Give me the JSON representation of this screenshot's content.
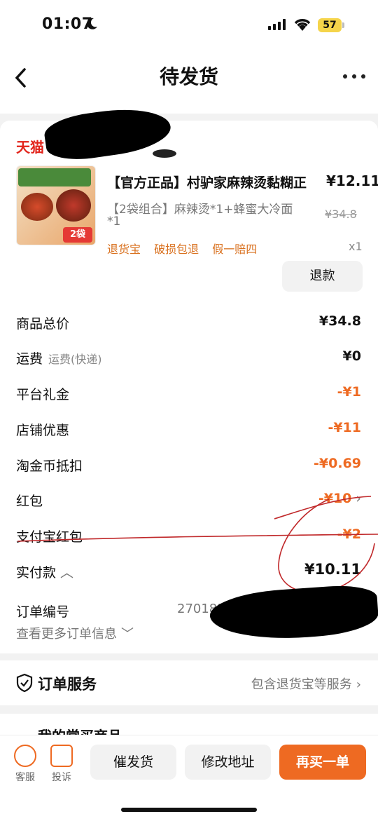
{
  "status": {
    "time": "01:07",
    "battery": "57"
  },
  "nav": {
    "title": "待发货"
  },
  "shop": {
    "brand": "天猫",
    "name_visible": "!!"
  },
  "product": {
    "image_badge": "2袋",
    "title": "【官方正品】村驴家麻辣烫黏糊正",
    "price": "¥12.11",
    "spec_line1": "【2袋组合】麻辣烫*1+蜂蜜大冷面",
    "spec_line2": "*1",
    "original_price": "¥34.8",
    "tags": [
      "退货宝",
      "破损包退",
      "假一赔四"
    ],
    "quantity": "x1",
    "refund_label": "退款"
  },
  "summary": {
    "rows": [
      {
        "label": "商品总价",
        "sub": "",
        "value": "¥34.8"
      },
      {
        "label": "运费",
        "sub": "运费(快递)",
        "value": "¥0"
      },
      {
        "label": "平台礼金",
        "sub": "",
        "value": "-¥1"
      },
      {
        "label": "店铺优惠",
        "sub": "",
        "value": "-¥11"
      },
      {
        "label": "淘金币抵扣",
        "sub": "",
        "value": "-¥0.69"
      },
      {
        "label": "红包",
        "sub": "",
        "value": "-¥10"
      },
      {
        "label": "支付宝红包",
        "sub": "",
        "value": "-¥2"
      },
      {
        "label": "实付款",
        "sub": "",
        "value": "¥10.11"
      }
    ]
  },
  "order": {
    "number_label": "订单编号",
    "number_visible": "27018371",
    "more_info": "查看更多订单信息"
  },
  "service": {
    "title": "订单服务",
    "right_text": "包含退货宝等服务"
  },
  "recent": {
    "title": "我的常买商品"
  },
  "bottom": {
    "service_label": "客服",
    "complain_label": "投诉",
    "urge_label": "催发货",
    "address_label": "修改地址",
    "rebuy_label": "再买一单"
  },
  "colors": {
    "accent": "#ee6a22",
    "tmall_red": "#e2231a"
  }
}
